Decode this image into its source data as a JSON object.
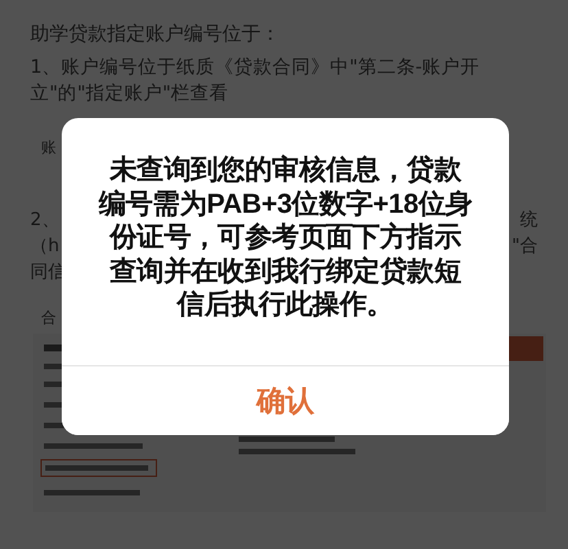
{
  "page": {
    "heading": "助学贷款指定账户编号位于：",
    "step_1": "1、账户编号位于纸质《贷款合同》中\"第二条-账户开立\"的\"指定账户\"栏查看",
    "fragment_left": "账",
    "step_2_left": [
      "2、",
      "（h",
      "同信"
    ],
    "step_2_right": [
      "统",
      "\"合"
    ],
    "image_label": "合"
  },
  "dialog": {
    "message": "未查询到您的审核信息，贷款编号需为PAB+3位数字+18位身份证号，可参考页面下方指示查询并在收到我行绑定贷款短信后执行此操作。",
    "button": "确认"
  }
}
